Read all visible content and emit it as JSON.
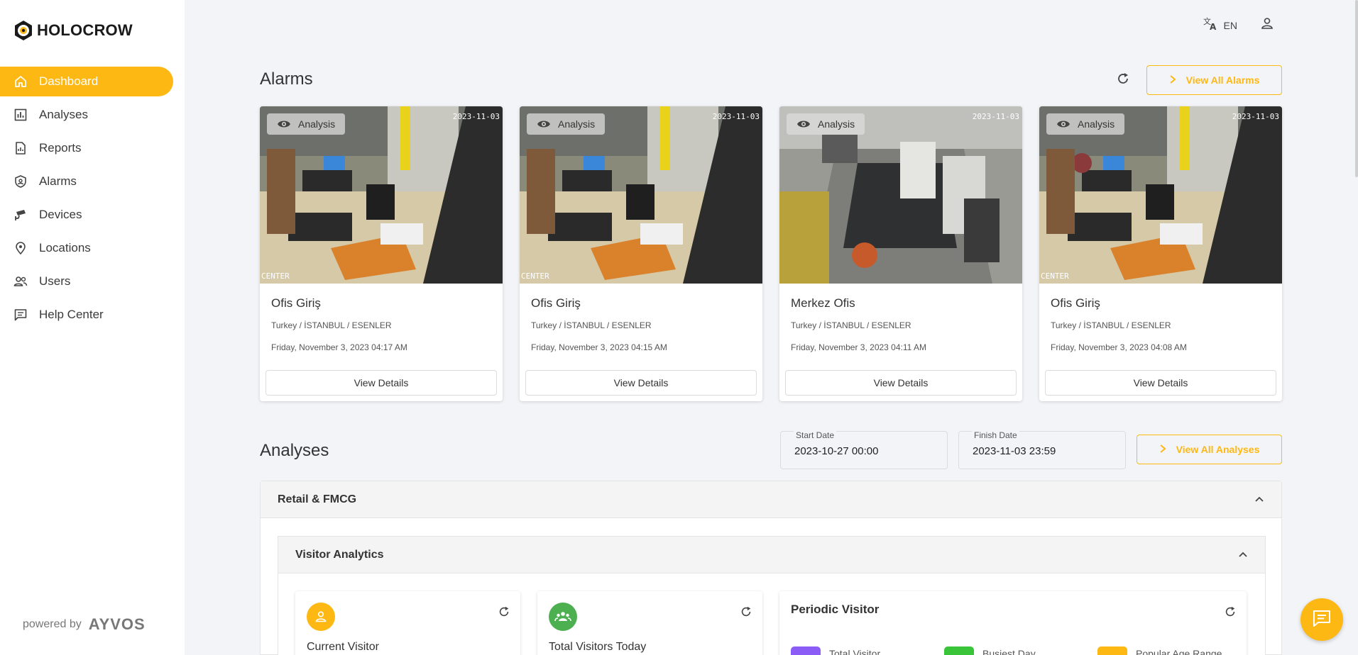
{
  "app": {
    "brand": "HOLOCROW"
  },
  "sidebar": {
    "items": [
      {
        "label": "Dashboard",
        "icon": "home-icon",
        "active": true
      },
      {
        "label": "Analyses",
        "icon": "bar-chart-icon"
      },
      {
        "label": "Reports",
        "icon": "report-icon"
      },
      {
        "label": "Alarms",
        "icon": "shield-icon"
      },
      {
        "label": "Devices",
        "icon": "camera-icon"
      },
      {
        "label": "Locations",
        "icon": "location-pin-icon"
      },
      {
        "label": "Users",
        "icon": "users-icon"
      },
      {
        "label": "Help Center",
        "icon": "chat-icon"
      }
    ],
    "powered_label": "powered by",
    "powered_brand": "AYVOS"
  },
  "topbar": {
    "language": "EN"
  },
  "alarms": {
    "title": "Alarms",
    "view_all_label": "View All Alarms",
    "cards": [
      {
        "badge": "Analysis",
        "camera_timestamp": "2023-11-03",
        "camera_tag": "CENTER",
        "title": "Ofis Giriş",
        "location": "Turkey / İSTANBUL / ESENLER",
        "time": "Friday, November 3, 2023 04:17 AM",
        "button": "View Details"
      },
      {
        "badge": "Analysis",
        "camera_timestamp": "2023-11-03",
        "camera_tag": "CENTER",
        "title": "Ofis Giriş",
        "location": "Turkey / İSTANBUL / ESENLER",
        "time": "Friday, November 3, 2023 04:15 AM",
        "button": "View Details"
      },
      {
        "badge": "Analysis",
        "camera_timestamp": "2023-11-03",
        "camera_tag": "",
        "title": "Merkez Ofis",
        "location": "Turkey / İSTANBUL / ESENLER",
        "time": "Friday, November 3, 2023 04:11 AM",
        "button": "View Details"
      },
      {
        "badge": "Analysis",
        "camera_timestamp": "2023-11-03",
        "camera_tag": "CENTER",
        "title": "Ofis Giriş",
        "location": "Turkey / İSTANBUL / ESENLER",
        "time": "Friday, November 3, 2023 04:08 AM",
        "button": "View Details"
      }
    ]
  },
  "analyses": {
    "title": "Analyses",
    "start_date_label": "Start Date",
    "start_date_value": "2023-10-27 00:00",
    "finish_date_label": "Finish Date",
    "finish_date_value": "2023-11-03 23:59",
    "view_all_label": "View All Analyses",
    "panel_title": "Retail & FMCG",
    "sub_panel_title": "Visitor Analytics",
    "stats": [
      {
        "label": "Current Visitor",
        "icon": "person-icon",
        "color": "#fdb813"
      },
      {
        "label": "Total Visitors Today",
        "icon": "group-icon",
        "color": "#4caf50"
      }
    ],
    "periodic": {
      "title": "Periodic Visitor",
      "legend": [
        {
          "label": "Total Visitor",
          "color": "#8b5cf6"
        },
        {
          "label": "Busiest Day",
          "color": "#3ac43a"
        },
        {
          "label": "Popular Age Range",
          "color": "#fdb813"
        }
      ]
    }
  },
  "colors": {
    "accent": "#fdb813",
    "background": "#f2f4f8"
  }
}
